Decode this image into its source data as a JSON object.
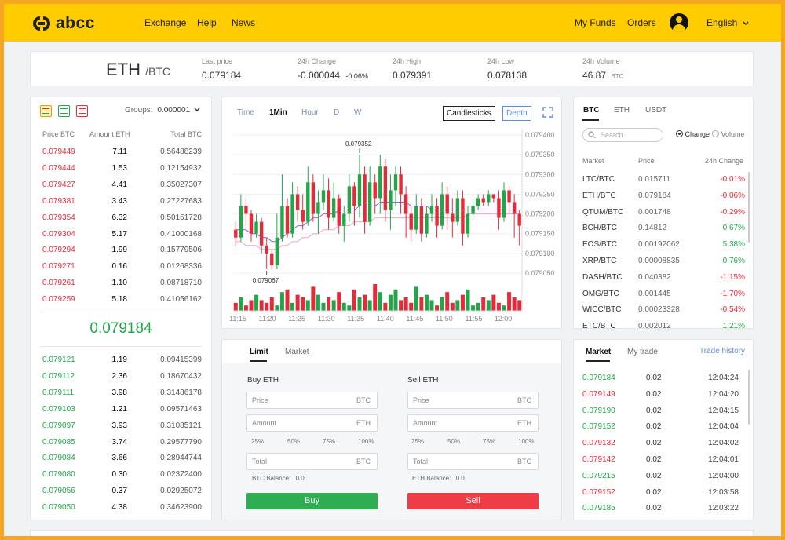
{
  "nav": {
    "logo_text": "abcc",
    "links": [
      "Exchange",
      "Help",
      "News"
    ],
    "my_funds": "My Funds",
    "orders": "Orders",
    "language": "English"
  },
  "ticker": {
    "base": "ETH",
    "quote": "/BTC",
    "last_price_label": "Last price",
    "last_price": "0.079184",
    "change_label": "24h Change",
    "change_value": "-0.000044",
    "change_pct": "-0.06%",
    "high_label": "24h High",
    "high": "0.079391",
    "low_label": "24h Low",
    "low": "0.078138",
    "volume_label": "24h Volume",
    "volume": "46.87",
    "volume_unit": "BTC"
  },
  "orderbook": {
    "groups_label": "Groups:",
    "groups_value": "0.000001",
    "col_price": "Price BTC",
    "col_amount": "Amount ETH",
    "col_total": "Total BTC",
    "mid_price": "0.079184",
    "asks": [
      [
        "0.079449",
        "7.11",
        "0.56488239"
      ],
      [
        "0.079444",
        "1.53",
        "0.12154932"
      ],
      [
        "0.079427",
        "4.41",
        "0.35027307"
      ],
      [
        "0.079381",
        "3.43",
        "0.27227683"
      ],
      [
        "0.079354",
        "6.32",
        "0.50151728"
      ],
      [
        "0.079304",
        "5.17",
        "0.41000168"
      ],
      [
        "0.079294",
        "1.99",
        "0.15779506"
      ],
      [
        "0.079271",
        "0.16",
        "0.01268336"
      ],
      [
        "0.079261",
        "1.10",
        "0.08718710"
      ],
      [
        "0.079259",
        "5.18",
        "0.41056162"
      ]
    ],
    "bids": [
      [
        "0.079121",
        "1.19",
        "0.09415399"
      ],
      [
        "0.079112",
        "2.36",
        "0.18670432"
      ],
      [
        "0.079111",
        "3.98",
        "0.31486178"
      ],
      [
        "0.079103",
        "1.21",
        "0.09571463"
      ],
      [
        "0.079097",
        "3.93",
        "0.31085121"
      ],
      [
        "0.079085",
        "3.74",
        "0.29577790"
      ],
      [
        "0.079084",
        "3.66",
        "0.28944744"
      ],
      [
        "0.079080",
        "0.30",
        "0.02372400"
      ],
      [
        "0.079056",
        "0.37",
        "0.02925072"
      ],
      [
        "0.079050",
        "4.38",
        "0.34623900"
      ]
    ]
  },
  "chart_toolbar": {
    "intervals": [
      "Time",
      "1Min",
      "Hour",
      "D",
      "W"
    ],
    "active_interval": "1Min",
    "candlesticks": "Candlesticks",
    "depth": "Depth"
  },
  "chart_data": {
    "type": "candlestick",
    "x_ticks": [
      "11:15",
      "11:20",
      "11:25",
      "11:30",
      "11:35",
      "11:40",
      "11:45",
      "11:50",
      "11:55",
      "12:00"
    ],
    "y_ticks": [
      "0.079400",
      "0.079350",
      "0.079300",
      "0.079250",
      "0.079200",
      "0.079150",
      "0.079100",
      "0.079050"
    ],
    "ylim": [
      0.07904,
      0.0794
    ],
    "high_annotation": "0.079352",
    "low_annotation": "0.079067",
    "up_color": "#23a64a",
    "down_color": "#e52a3a",
    "candles": [
      [
        0.07916,
        0.07914,
        0.07918,
        0.07912
      ],
      [
        0.07914,
        0.07922,
        0.07925,
        0.07913
      ],
      [
        0.07922,
        0.0792,
        0.07924,
        0.07917
      ],
      [
        0.0792,
        0.07915,
        0.07921,
        0.07913
      ],
      [
        0.07915,
        0.07918,
        0.0792,
        0.07914
      ],
      [
        0.07918,
        0.07912,
        0.07919,
        0.0791
      ],
      [
        0.07912,
        0.0791,
        0.07914,
        0.07906
      ],
      [
        0.0791,
        0.07907,
        0.07911,
        0.07906
      ],
      [
        0.07907,
        0.07914,
        0.0792,
        0.07906
      ],
      [
        0.07914,
        0.07922,
        0.0793,
        0.07913
      ],
      [
        0.07922,
        0.07915,
        0.07924,
        0.07914
      ],
      [
        0.07915,
        0.07925,
        0.07928,
        0.07914
      ],
      [
        0.07925,
        0.07921,
        0.07927,
        0.07918
      ],
      [
        0.07921,
        0.07918,
        0.07925,
        0.07916
      ],
      [
        0.07918,
        0.07928,
        0.07932,
        0.07917
      ],
      [
        0.07928,
        0.0792,
        0.0793,
        0.07918
      ],
      [
        0.0792,
        0.07923,
        0.07926,
        0.07915
      ],
      [
        0.07923,
        0.07926,
        0.0793,
        0.07921
      ],
      [
        0.07926,
        0.07919,
        0.07929,
        0.07916
      ],
      [
        0.07919,
        0.07924,
        0.07928,
        0.07918
      ],
      [
        0.07924,
        0.07917,
        0.07925,
        0.07915
      ],
      [
        0.07917,
        0.0792,
        0.07922,
        0.07913
      ],
      [
        0.0792,
        0.07927,
        0.0793,
        0.07918
      ],
      [
        0.07927,
        0.07922,
        0.07928,
        0.07917
      ],
      [
        0.07922,
        0.0793,
        0.07935,
        0.07919
      ],
      [
        0.0793,
        0.07918,
        0.07932,
        0.07915
      ],
      [
        0.07918,
        0.07928,
        0.07932,
        0.07917
      ],
      [
        0.07928,
        0.07924,
        0.0793,
        0.0792
      ],
      [
        0.07924,
        0.07932,
        0.07935,
        0.0792
      ],
      [
        0.07932,
        0.07921,
        0.07934,
        0.07918
      ],
      [
        0.07921,
        0.07926,
        0.0793,
        0.07916
      ],
      [
        0.07926,
        0.0793,
        0.07932,
        0.07922
      ],
      [
        0.0793,
        0.07925,
        0.07932,
        0.0792
      ],
      [
        0.07925,
        0.0792,
        0.07927,
        0.07914
      ],
      [
        0.0792,
        0.07916,
        0.07922,
        0.07913
      ],
      [
        0.07916,
        0.07922,
        0.07925,
        0.07915
      ],
      [
        0.07922,
        0.07915,
        0.07924,
        0.07913
      ],
      [
        0.07915,
        0.0792,
        0.07922,
        0.07914
      ],
      [
        0.0792,
        0.07922,
        0.07925,
        0.07918
      ],
      [
        0.07922,
        0.07917,
        0.07924,
        0.07914
      ],
      [
        0.07917,
        0.07925,
        0.07928,
        0.07916
      ],
      [
        0.07925,
        0.0792,
        0.07927,
        0.07916
      ],
      [
        0.0792,
        0.07918,
        0.07924,
        0.07914
      ],
      [
        0.07918,
        0.07924,
        0.07926,
        0.07917
      ],
      [
        0.07924,
        0.07915,
        0.07926,
        0.07912
      ],
      [
        0.07915,
        0.0792,
        0.07922,
        0.07914
      ],
      [
        0.0792,
        0.07922,
        0.07924,
        0.07919
      ],
      [
        0.07922,
        0.07924,
        0.07925,
        0.07921
      ],
      [
        0.07924,
        0.07923,
        0.07925,
        0.07922
      ],
      [
        0.07923,
        0.07925,
        0.07926,
        0.07922
      ],
      [
        0.07925,
        0.07924,
        0.07925,
        0.07923
      ],
      [
        0.07924,
        0.07919,
        0.07926,
        0.07916
      ],
      [
        0.07919,
        0.07926,
        0.07928,
        0.07918
      ],
      [
        0.07926,
        0.07923,
        0.07927,
        0.0792
      ],
      [
        0.07923,
        0.0792,
        0.07925,
        0.07914
      ],
      [
        0.0792,
        0.07917,
        0.07921,
        0.07912
      ]
    ],
    "volumes": [
      3,
      5,
      2,
      4,
      6,
      4,
      3,
      5,
      2,
      7,
      8,
      3,
      6,
      5,
      4,
      9,
      6,
      3,
      5,
      4,
      7,
      3,
      2,
      8,
      5,
      6,
      4,
      10,
      7,
      3,
      6,
      8,
      4,
      5,
      3,
      9,
      5,
      6,
      4,
      2,
      5,
      7,
      3,
      4,
      6,
      8,
      2,
      3,
      5,
      4,
      6,
      3,
      2,
      7,
      5,
      4
    ],
    "ma_slow": [
      0.07916,
      0.07916,
      0.07916,
      0.07915,
      0.07915,
      0.07914,
      0.07914,
      0.07913,
      0.07913,
      0.07914,
      0.07915,
      0.07916,
      0.07917,
      0.07917,
      0.07918,
      0.07919,
      0.07919,
      0.0792,
      0.0792,
      0.0792,
      0.07921,
      0.07921,
      0.07921,
      0.07921,
      0.07922,
      0.07922,
      0.07922,
      0.07922,
      0.07923,
      0.07923,
      0.07923,
      0.07923,
      0.07923,
      0.07923,
      0.07922,
      0.07922,
      0.07922,
      0.07922,
      0.07921,
      0.07921,
      0.07921,
      0.07921,
      0.07921,
      0.07921,
      0.07921,
      0.07921,
      0.07921,
      0.07921,
      0.07921,
      0.07921,
      0.07921,
      0.07921,
      0.07921,
      0.07921,
      0.07921,
      0.07921
    ],
    "ma_fast": [
      0.07913,
      0.07913,
      0.07912,
      0.07912,
      0.07912,
      0.07911,
      0.07911,
      0.07911,
      0.07911,
      0.07912,
      0.07912,
      0.07913,
      0.07913,
      0.07914,
      0.07914,
      0.07915,
      0.07915,
      0.07916,
      0.07916,
      0.07916,
      0.07917,
      0.07917,
      0.07917,
      0.07918,
      0.07918,
      0.07918,
      0.07918,
      0.07919,
      0.07919,
      0.07919,
      0.07919,
      0.07919,
      0.07919,
      0.07919,
      0.07919,
      0.07919,
      0.07919,
      0.07919,
      0.07919,
      0.07919,
      0.07919,
      0.07919,
      0.07919,
      0.07919,
      0.07919,
      0.0792,
      0.0792,
      0.0792,
      0.0792,
      0.0792,
      0.0792,
      0.0792,
      0.0792,
      0.0792,
      0.0792,
      0.0792
    ]
  },
  "order_form": {
    "tabs": [
      "Limit",
      "Market"
    ],
    "active_tab": "Limit",
    "buy": {
      "title": "Buy ETH",
      "price_ph": "Price",
      "price_unit": "BTC",
      "amount_ph": "Amount",
      "amount_unit": "ETH",
      "total_ph": "Total",
      "total_unit": "BTC",
      "balance_label": "BTC Balance:",
      "balance_value": "0.0",
      "button": "Buy"
    },
    "sell": {
      "title": "Sell ETH",
      "price_ph": "Price",
      "price_unit": "BTC",
      "amount_ph": "Amount",
      "amount_unit": "ETH",
      "total_ph": "Total",
      "total_unit": "BTC",
      "balance_label": "ETH Balance:",
      "balance_value": "0.0",
      "button": "Sell"
    },
    "percents": [
      "25%",
      "50%",
      "75%",
      "100%"
    ],
    "buy_color": "#2ead52",
    "sell_color": "#ef3d47"
  },
  "markets": {
    "tabs": [
      "BTC",
      "ETH",
      "USDT"
    ],
    "active_tab": "BTC",
    "search_ph": "Search",
    "toggle_change": "Change",
    "toggle_volume": "Volume",
    "col_market": "Market",
    "col_price": "Price",
    "col_change": "24h Change",
    "rows": [
      [
        "LTC/BTC",
        "0.015711",
        "-0.01%",
        "down"
      ],
      [
        "ETH/BTC",
        "0.079184",
        "-0.06%",
        "down"
      ],
      [
        "QTUM/BTC",
        "0.001748",
        "-0.29%",
        "down"
      ],
      [
        "BCH/BTC",
        "0.14812",
        "0.67%",
        "up"
      ],
      [
        "EOS/BTC",
        "0.00192062",
        "5.38%",
        "up"
      ],
      [
        "XRP/BTC",
        "0.00008835",
        "0.76%",
        "up"
      ],
      [
        "DASH/BTC",
        "0.040382",
        "-1.15%",
        "down"
      ],
      [
        "OMG/BTC",
        "0.001445",
        "-1.70%",
        "down"
      ],
      [
        "WICC/BTC",
        "0.00023328",
        "-0.54%",
        "down"
      ],
      [
        "ETC/BTC",
        "0.002012",
        "1.21%",
        "up"
      ]
    ]
  },
  "trades": {
    "tabs": [
      "Market",
      "My trade"
    ],
    "active_tab": "Market",
    "history_link": "Trade history",
    "rows": [
      [
        "0.079184",
        "0.02",
        "12:04:24",
        "up"
      ],
      [
        "0.079149",
        "0.02",
        "12:04:20",
        "down"
      ],
      [
        "0.079190",
        "0.02",
        "12:04:15",
        "up"
      ],
      [
        "0.079152",
        "0.02",
        "12:04:04",
        "up"
      ],
      [
        "0.079132",
        "0.02",
        "12:04:02",
        "down"
      ],
      [
        "0.079142",
        "0.02",
        "12:04:01",
        "down"
      ],
      [
        "0.079215",
        "0.02",
        "12:04:00",
        "up"
      ],
      [
        "0.079152",
        "0.02",
        "12:03:58",
        "down"
      ],
      [
        "0.079185",
        "0.02",
        "12:03:22",
        "up"
      ]
    ]
  }
}
